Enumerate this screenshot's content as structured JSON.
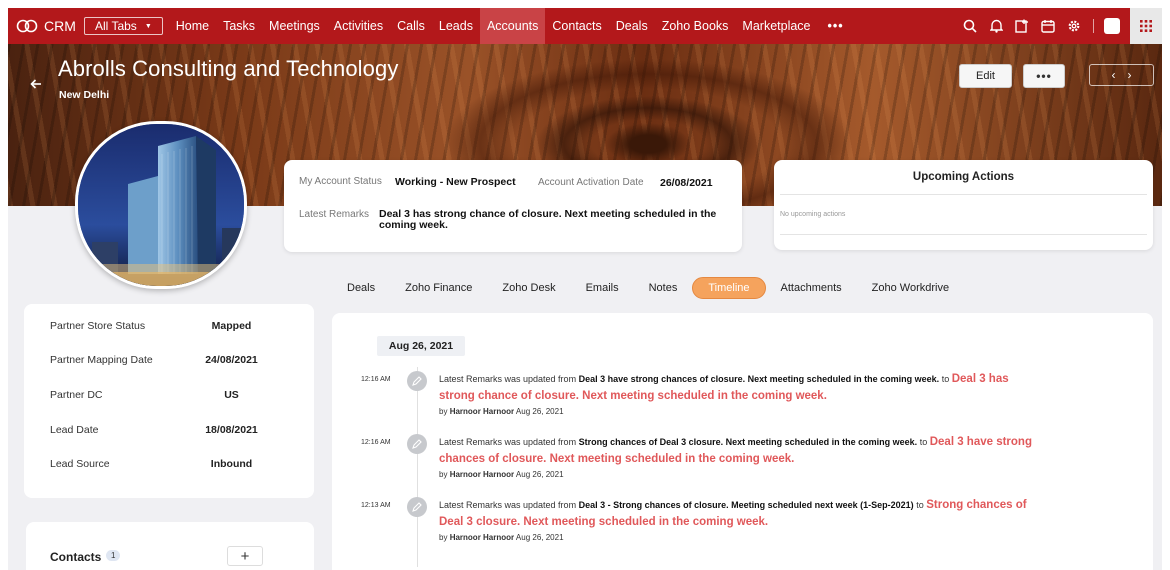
{
  "nav": {
    "brand": "CRM",
    "all_tabs": "All Tabs",
    "items": [
      "Home",
      "Tasks",
      "Meetings",
      "Activities",
      "Calls",
      "Leads",
      "Accounts",
      "Contacts",
      "Deals",
      "Zoho Books",
      "Marketplace"
    ],
    "active": "Accounts",
    "more": "•••",
    "icons": [
      "search-icon",
      "bell-icon",
      "add-task-icon",
      "calendar-icon",
      "gear-icon",
      "avatar-icon",
      "app-grid-icon"
    ]
  },
  "account": {
    "name": "Abrolls Consulting and Technology",
    "city": "New Delhi"
  },
  "actions": {
    "edit": "Edit",
    "more": "•••"
  },
  "info": {
    "status_label": "My Account Status",
    "status_value": "Working - New Prospect",
    "activation_label": "Account Activation Date",
    "activation_value": "26/08/2021",
    "remarks_label": "Latest Remarks",
    "remarks_value": "Deal 3 has strong chance of closure. Next meeting scheduled in the coming week."
  },
  "upcoming": {
    "title": "Upcoming Actions",
    "empty": "No upcoming actions"
  },
  "tabs": [
    "Deals",
    "Zoho Finance",
    "Zoho Desk",
    "Emails",
    "Notes",
    "Timeline",
    "Attachments",
    "Zoho Workdrive"
  ],
  "active_tab": "Timeline",
  "details": [
    {
      "label": "Partner Store Status",
      "value": "Mapped"
    },
    {
      "label": "Partner Mapping Date",
      "value": "24/08/2021"
    },
    {
      "label": "Partner DC",
      "value": "US"
    },
    {
      "label": "Lead Date",
      "value": "18/08/2021"
    },
    {
      "label": "Lead Source",
      "value": "Inbound"
    }
  ],
  "contacts": {
    "title": "Contacts",
    "count": "1",
    "add": "+"
  },
  "timeline": {
    "date": "Aug 26, 2021",
    "entries": [
      {
        "time": "12:16 AM",
        "prefix": "Latest Remarks was updated from",
        "from": "Deal 3 have strong chances of closure. Next meeting scheduled in the coming week.",
        "to_word": "to",
        "to": "Deal 3 has strong chance of closure. Next meeting scheduled in the coming week.",
        "by_prefix": "by",
        "by": "Harnoor Harnoor",
        "date": "Aug 26, 2021"
      },
      {
        "time": "12:16 AM",
        "prefix": "Latest Remarks was updated from",
        "from": "Strong chances of Deal 3 closure. Next meeting scheduled in the coming week.",
        "to_word": "to",
        "to": "Deal 3 have strong chances of closure. Next meeting scheduled in the coming week.",
        "by_prefix": "by",
        "by": "Harnoor Harnoor",
        "date": "Aug 26, 2021"
      },
      {
        "time": "12:13 AM",
        "prefix": "Latest Remarks was updated from",
        "from": "Deal 3 - Strong chances of closure. Meeting scheduled next week (1-Sep-2021)",
        "to_word": "to",
        "to": "Strong chances of Deal 3 closure. Next meeting scheduled in the coming week.",
        "by_prefix": "by",
        "by": "Harnoor Harnoor",
        "date": "Aug 26, 2021"
      }
    ]
  }
}
